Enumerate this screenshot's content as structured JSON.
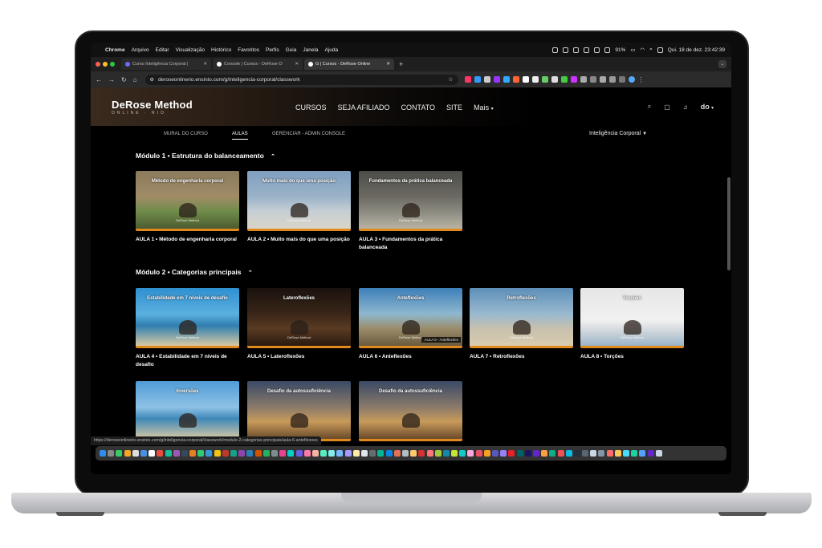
{
  "menubar": {
    "app": "Chrome",
    "items": [
      "Arquivo",
      "Editar",
      "Visualização",
      "Histórico",
      "Favoritos",
      "Perfis",
      "Guia",
      "Janela",
      "Ajuda"
    ],
    "battery": "91%",
    "datetime": "Qui. 18 de dez. 23:42:39"
  },
  "tabs": [
    {
      "label": "Curso Inteligência Corporal |",
      "active": false
    },
    {
      "label": "Console | Cursos - DeRose O",
      "active": false
    },
    {
      "label": "G | Cursos - DeRose Online",
      "active": true
    }
  ],
  "address": {
    "url": "deroseonlinerio.ensinio.com/g/inteligencia-corporal/classwork"
  },
  "site": {
    "logo_main": "DeRose Method",
    "logo_sub": "ONLINE · RIO",
    "nav": [
      "CURSOS",
      "SEJA AFILIADO",
      "CONTATO",
      "SITE",
      "Mais"
    ],
    "user_initials": "do",
    "subtabs": [
      "MURAL DO CURSO",
      "AULAS",
      "GERENCIAR - ADMIN CONSOLE"
    ],
    "active_subtab": "AULAS",
    "course_selector": "Inteligência Corporal"
  },
  "modules": [
    {
      "title": "Módulo 1 • Estrutura do balanceamento",
      "lessons": [
        {
          "thumb_title": "Método de engenharia corporal",
          "caption": "AULA 1 • Método de engenharia corporal"
        },
        {
          "thumb_title": "Muito mais do que uma posição",
          "caption": "AULA 2 • Muito mais do que uma posição"
        },
        {
          "thumb_title": "Fundamentos da prática balanceada",
          "caption": "AULA 3 • Fundamentos da prática balanceada"
        }
      ]
    },
    {
      "title": "Módulo 2 • Categorias principais",
      "lessons": [
        {
          "thumb_title": "Estabilidade em 7 níveis de desafio",
          "caption": "AULA 4 • Estabilidade em 7 níveis de desafio"
        },
        {
          "thumb_title": "Lateroflexões",
          "caption": "AULA 5 • Lateroflexões"
        },
        {
          "thumb_title": "Anteflexões",
          "caption": "AULA 6 • Anteflexões",
          "hover_tip": "AULA 6 - Anteflexões"
        },
        {
          "thumb_title": "Retroflexões",
          "caption": "AULA 7 • Retroflexões"
        },
        {
          "thumb_title": "Torções",
          "caption": "AULA 8 • Torções"
        }
      ],
      "more": [
        {
          "thumb_title": "Inversões"
        },
        {
          "thumb_title": "Desafio da autossuficiência"
        },
        {
          "thumb_title": "Desafio da autossuficiência"
        }
      ]
    }
  ],
  "thumb_watermark": "DeRose Method",
  "status_url": "https://deroseonlinerio.ensinio.com/g/inteligencia-corporal/classwork/modulo-2-categorias-principais/aula-6-anteflexoes",
  "colors": {
    "accent_bar": "#e08a1e",
    "page_bg": "#000000",
    "header_gradient_start": "#3a2a1e"
  }
}
